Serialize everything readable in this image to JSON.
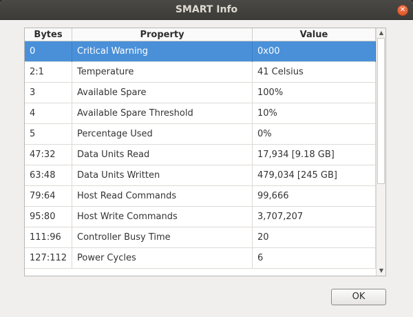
{
  "window": {
    "title": "SMART Info"
  },
  "table": {
    "headers": [
      "Bytes",
      "Property",
      "Value"
    ],
    "rows": [
      {
        "bytes": "0",
        "property": "Critical Warning",
        "value": "0x00",
        "selected": true
      },
      {
        "bytes": "2:1",
        "property": "Temperature",
        "value": "41 Celsius"
      },
      {
        "bytes": "3",
        "property": "Available Spare",
        "value": "100%"
      },
      {
        "bytes": "4",
        "property": "Available Spare Threshold",
        "value": "10%"
      },
      {
        "bytes": "5",
        "property": "Percentage Used",
        "value": "0%"
      },
      {
        "bytes": "47:32",
        "property": "Data Units Read",
        "value": "17,934 [9.18 GB]"
      },
      {
        "bytes": "63:48",
        "property": "Data Units Written",
        "value": "479,034 [245 GB]"
      },
      {
        "bytes": "79:64",
        "property": "Host Read Commands",
        "value": "99,666"
      },
      {
        "bytes": "95:80",
        "property": "Host Write Commands",
        "value": "3,707,207"
      },
      {
        "bytes": "111:96",
        "property": "Controller Busy Time",
        "value": "20"
      },
      {
        "bytes": "127:112",
        "property": "Power Cycles",
        "value": "6"
      }
    ]
  },
  "buttons": {
    "ok": "OK"
  },
  "icons": {
    "close": "close-icon",
    "scroll_up": "triangle-up-icon",
    "scroll_down": "triangle-down-icon"
  },
  "colors": {
    "selection": "#4a90d9",
    "titlebar": "#3c3b37",
    "close": "#e05a2b"
  }
}
